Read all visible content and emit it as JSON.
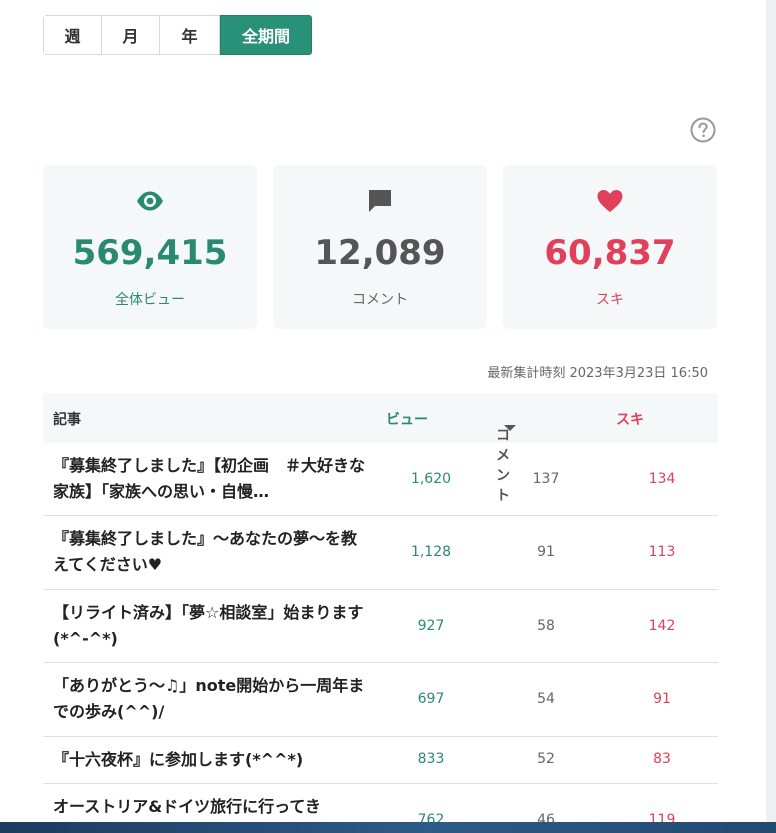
{
  "period_tabs": {
    "week": "週",
    "month": "月",
    "year": "年",
    "all": "全期間",
    "active": "all"
  },
  "colors": {
    "accent": "#2a9179",
    "views": "#2a8a71",
    "likes": "#e2405a"
  },
  "stats": {
    "views": {
      "value": "569,415",
      "label": "全体ビュー",
      "icon": "eye-icon"
    },
    "comments": {
      "value": "12,089",
      "label": "コメント",
      "icon": "comment-icon"
    },
    "likes": {
      "value": "60,837",
      "label": "スキ",
      "icon": "heart-icon"
    }
  },
  "timestamp": "最新集計時刻 2023年3月23日 16:50",
  "table": {
    "headers": {
      "article": "記事",
      "views": "ビュー",
      "comments": "コメント",
      "likes": "スキ"
    },
    "rows": [
      {
        "title": "『募集終了しました』【初企画　＃大好きな家族】「家族への思い・自慢…",
        "views": "1,620",
        "comments": "137",
        "likes": "134"
      },
      {
        "title": "『募集終了しました』～あなたの夢～を教えてください♥",
        "views": "1,128",
        "comments": "91",
        "likes": "113"
      },
      {
        "title": "【リライト済み】「夢☆相談室」始まります(*^-^*)",
        "views": "927",
        "comments": "58",
        "likes": "142"
      },
      {
        "title": "「ありがとう～♫」note開始から一周年までの歩み(^^)/",
        "views": "697",
        "comments": "54",
        "likes": "91"
      },
      {
        "title": "『十六夜杯』に参加します(*^^*)",
        "views": "833",
        "comments": "52",
        "likes": "83"
      },
      {
        "title": "オーストリア&ドイツ旅行に行ってき",
        "views": "762",
        "comments": "46",
        "likes": "119"
      }
    ]
  }
}
